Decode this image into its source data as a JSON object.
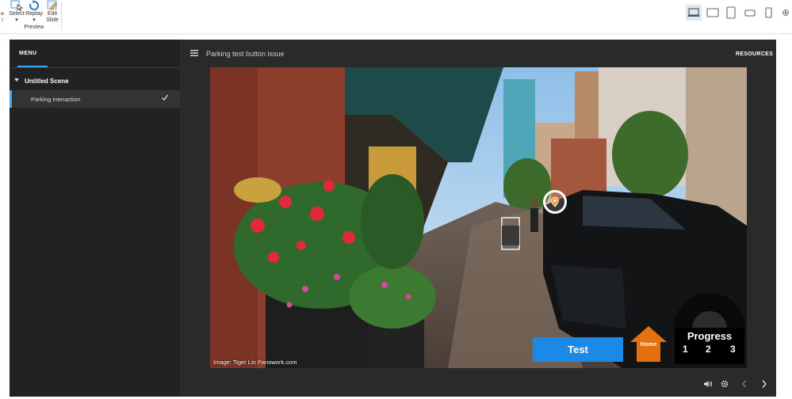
{
  "toolbar": {
    "partial_left_label": "w\nt",
    "select_label": "Select",
    "replay_label": "Replay",
    "edit_slide_label": "Edit\nSlide",
    "preview_group_label": "Preview",
    "devices": [
      "desktop-icon",
      "tablet-landscape-icon",
      "tablet-portrait-icon",
      "phone-landscape-icon",
      "phone-portrait-icon",
      "settings-gear-icon"
    ]
  },
  "sidebar": {
    "menu_label": "MENU",
    "scene_title": "Untitled Scene",
    "slides": [
      {
        "label": "Parking interaction",
        "visited": true
      }
    ]
  },
  "topbar": {
    "title": "Parking test button issue",
    "resources_label": "RESOURCES"
  },
  "slide": {
    "credit": "Image: Tiger Lin Panowork.com",
    "test_button_label": "Test",
    "home_button_label": "Home",
    "progress_title": "Progress",
    "progress_numbers": [
      "1",
      "2",
      "3"
    ],
    "colors": {
      "test_button": "#1b8ae6",
      "home_button": "#e5700f",
      "progress_box": "#000000"
    }
  },
  "controls": [
    "volume-icon",
    "settings-icon",
    "prev-arrow-icon",
    "next-arrow-icon"
  ]
}
